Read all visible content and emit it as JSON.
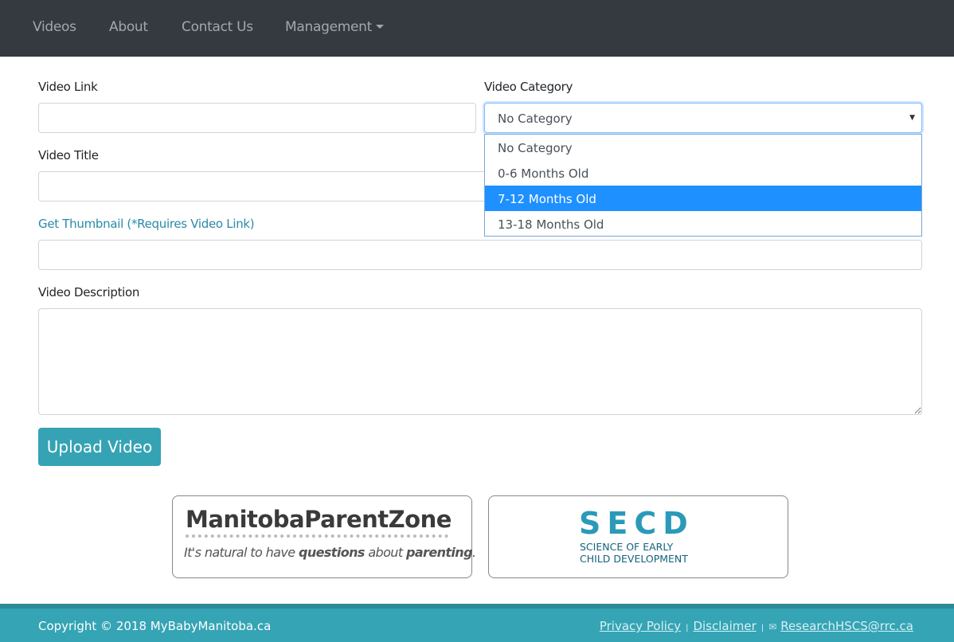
{
  "nav": {
    "items": [
      "Videos",
      "About",
      "Contact Us",
      "Management"
    ]
  },
  "form": {
    "video_link_label": "Video Link",
    "video_link_value": "",
    "video_category_label": "Video Category",
    "video_category_value": "No Category",
    "category_options": [
      "No Category",
      "0-6 Months Old",
      "7-12 Months Old",
      "13-18 Months Old"
    ],
    "highlighted_option": "7-12 Months Old",
    "video_title_label": "Video Title",
    "video_title_value": "",
    "thumbnail_label": "Get Thumbnail (*Requires Video Link)",
    "thumbnail_value": "",
    "description_label": "Video Description",
    "description_value": "",
    "upload_label": "Upload Video"
  },
  "logos": {
    "mpz_title": "ManitobaParentZone",
    "mpz_tagline_1": "It's natural to have ",
    "mpz_tagline_2": "questions",
    "mpz_tagline_3": " about ",
    "mpz_tagline_4": "parenting",
    "mpz_tagline_5": ".",
    "secd_title": "SECD",
    "secd_line1": "SCIENCE OF EARLY",
    "secd_line2": "CHILD DEVELOPMENT"
  },
  "footer": {
    "copyright": "Copyright © 2018 MyBabyManitoba.ca",
    "privacy": "Privacy Policy",
    "disclaimer": "Disclaimer",
    "email": "ResearchHSCS@rrc.ca"
  },
  "colors": {
    "navbar": "#343a40",
    "accent": "#35a3b4",
    "highlight": "#1e90ff"
  }
}
